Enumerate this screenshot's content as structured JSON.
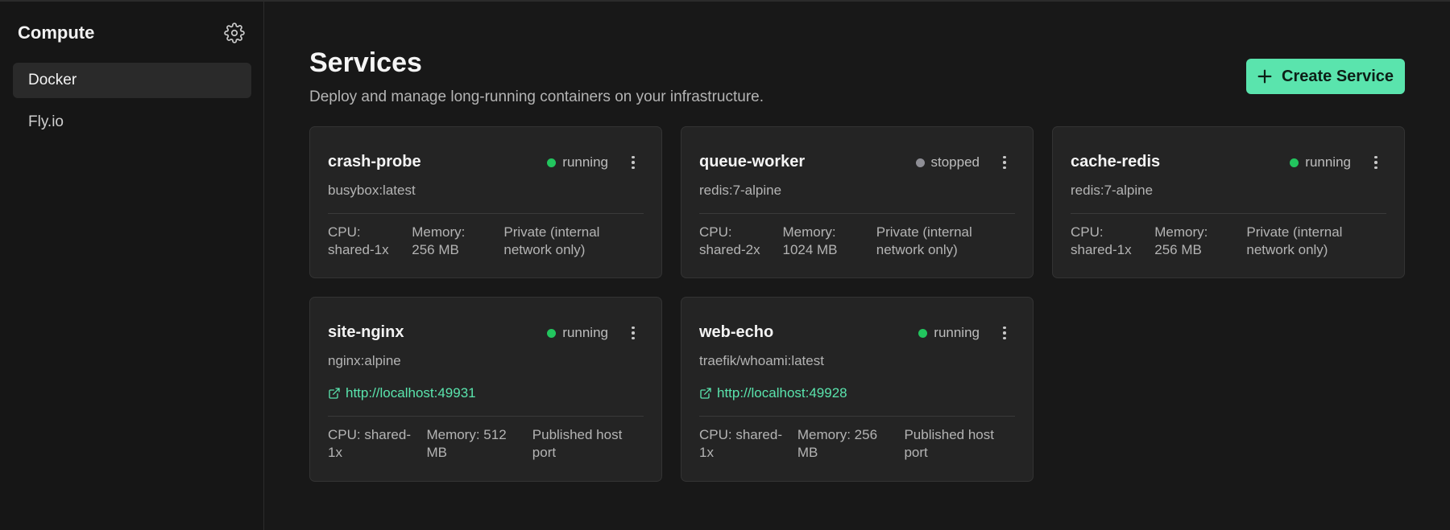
{
  "sidebar": {
    "title": "Compute",
    "items": [
      {
        "label": "Docker",
        "active": true
      },
      {
        "label": "Fly.io",
        "active": false
      }
    ]
  },
  "header": {
    "title": "Services",
    "subtitle": "Deploy and manage long-running containers on your infrastructure.",
    "create_label": "Create Service"
  },
  "colors": {
    "accent": "#5ae4ad",
    "running": "#22c55e",
    "stopped": "#8e8e95"
  },
  "services": [
    {
      "name": "crash-probe",
      "status": "running",
      "image": "busybox:latest",
      "link": "",
      "cpu": "CPU: shared-1x",
      "memory": "Memory: 256 MB",
      "network": "Private (internal network only)"
    },
    {
      "name": "queue-worker",
      "status": "stopped",
      "image": "redis:7-alpine",
      "link": "",
      "cpu": "CPU: shared-2x",
      "memory": "Memory: 1024 MB",
      "network": "Private (internal network only)"
    },
    {
      "name": "cache-redis",
      "status": "running",
      "image": "redis:7-alpine",
      "link": "",
      "cpu": "CPU: shared-1x",
      "memory": "Memory: 256 MB",
      "network": "Private (internal network only)"
    },
    {
      "name": "site-nginx",
      "status": "running",
      "image": "nginx:alpine",
      "link": "http://localhost:49931",
      "cpu": "CPU: shared-1x",
      "memory": "Memory: 512 MB",
      "network": "Published host port"
    },
    {
      "name": "web-echo",
      "status": "running",
      "image": "traefik/whoami:latest",
      "link": "http://localhost:49928",
      "cpu": "CPU: shared-1x",
      "memory": "Memory: 256 MB",
      "network": "Published host port"
    }
  ]
}
